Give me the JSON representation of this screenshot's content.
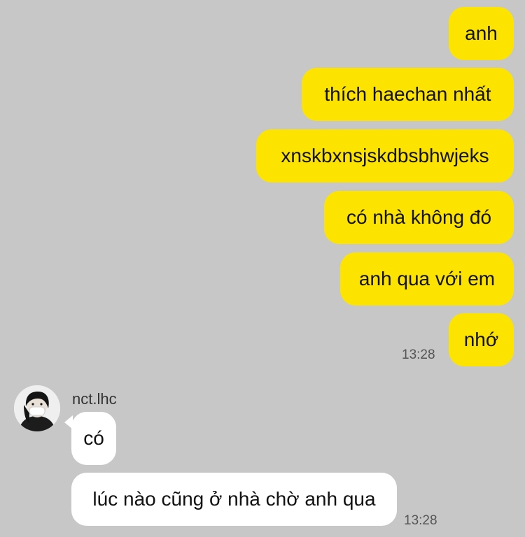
{
  "outgoing": [
    {
      "text": "anh"
    },
    {
      "text": "thích haechan nhất"
    },
    {
      "text": "xnskbxnsjskdbsbhwjeks"
    },
    {
      "text": "có nhà không đó"
    },
    {
      "text": "anh qua với em"
    },
    {
      "text": "nhớ"
    }
  ],
  "outgoing_time": "13:28",
  "incoming": {
    "sender": "nct.lhc",
    "avatar_icon": "profile-photo-person-with-mask-icon",
    "messages": [
      {
        "text": "có"
      },
      {
        "text": "lúc nào cũng ở nhà chờ anh qua"
      }
    ],
    "time": "13:28"
  },
  "colors": {
    "background": "#c7c7c7",
    "outgoing_bubble": "#fde400",
    "incoming_bubble": "#ffffff"
  }
}
